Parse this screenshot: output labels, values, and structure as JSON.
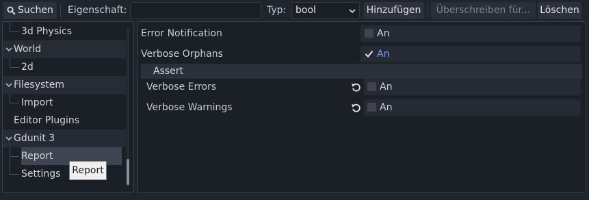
{
  "toolbar": {
    "search_label": "Suchen",
    "property_label": "Eigenschaft:",
    "property_value": "",
    "type_label": "Typ:",
    "type_value": "bool",
    "add_label": "Hinzufügen",
    "override_label": "Überschreiben für...",
    "delete_label": "Löschen"
  },
  "tree": {
    "items": [
      {
        "label": "3d Physics",
        "kind": "child"
      },
      {
        "label": "World",
        "kind": "section"
      },
      {
        "label": "2d",
        "kind": "child"
      },
      {
        "label": "Filesystem",
        "kind": "section"
      },
      {
        "label": "Import",
        "kind": "child"
      },
      {
        "label": "Editor Plugins",
        "kind": "plain"
      },
      {
        "label": "Gdunit 3",
        "kind": "section"
      },
      {
        "label": "Report",
        "kind": "child",
        "selected": true
      },
      {
        "label": "Settings",
        "kind": "child"
      }
    ]
  },
  "properties": {
    "error_notification": {
      "label": "Error Notification",
      "value_label": "An",
      "checked": false
    },
    "verbose_orphans": {
      "label": "Verbose Orphans",
      "value_label": "An",
      "checked": true
    },
    "assert_header": "Assert",
    "verbose_errors": {
      "label": "Verbose Errors",
      "value_label": "An",
      "checked": false
    },
    "verbose_warnings": {
      "label": "Verbose Warnings",
      "value_label": "An",
      "checked": false
    }
  },
  "tooltip": {
    "text": "Report"
  },
  "colors": {
    "background": "#20242d",
    "panel": "#1b1f26",
    "accent": "#6d9ff1",
    "selected": "#3e4452"
  },
  "icons": [
    "search-icon",
    "chevron-down-icon",
    "caret-down-icon",
    "checkmark-icon",
    "revert-icon"
  ]
}
